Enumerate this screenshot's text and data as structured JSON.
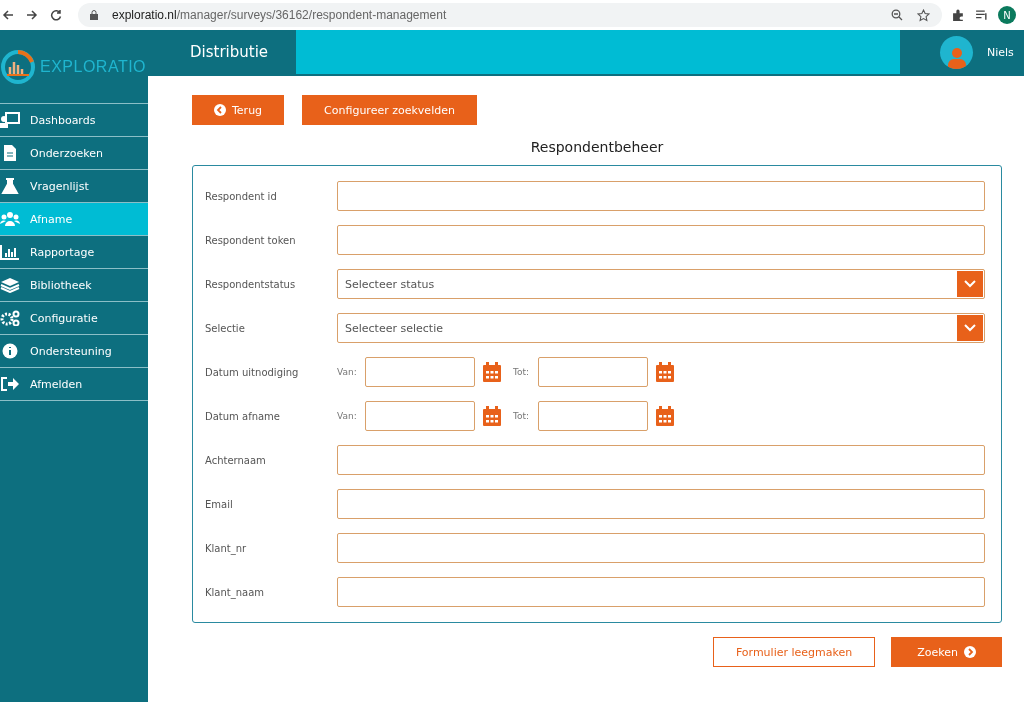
{
  "browser": {
    "url_host": "exploratio.nl",
    "url_path": "/manager/surveys/36162/respondent-management",
    "profile_initial": "N"
  },
  "logo": {
    "text": "EXPLORATIO"
  },
  "header": {
    "section": "Distributie",
    "user": "Niels"
  },
  "sidebar": {
    "items": [
      {
        "label": "Dashboards",
        "selected": false
      },
      {
        "label": "Onderzoeken",
        "selected": false
      },
      {
        "label": "Vragenlijst",
        "selected": false
      },
      {
        "label": "Afname",
        "selected": true
      },
      {
        "label": "Rapportage",
        "selected": false
      },
      {
        "label": "Bibliotheek",
        "selected": false
      },
      {
        "label": "Configuratie",
        "selected": false
      },
      {
        "label": "Ondersteuning",
        "selected": false
      },
      {
        "label": "Afmelden",
        "selected": false
      }
    ]
  },
  "toolbar": {
    "back_button": "Terug",
    "configure_button": "Configureer zoekvelden"
  },
  "form": {
    "title": "Respondentbeheer",
    "fields": [
      {
        "kind": "text",
        "label": "Respondent id"
      },
      {
        "kind": "text",
        "label": "Respondent token"
      },
      {
        "kind": "select",
        "label": "Respondentstatus",
        "placeholder": "Selecteer status"
      },
      {
        "kind": "select",
        "label": "Selectie",
        "placeholder": "Selecteer selectie"
      },
      {
        "kind": "daterange",
        "label": "Datum uitnodiging",
        "from_label": "Van:",
        "to_label": "Tot:"
      },
      {
        "kind": "daterange",
        "label": "Datum afname",
        "from_label": "Van:",
        "to_label": "Tot:"
      },
      {
        "kind": "text",
        "label": "Achternaam"
      },
      {
        "kind": "text",
        "label": "Email"
      },
      {
        "kind": "text",
        "label": "Klant_nr"
      },
      {
        "kind": "text",
        "label": "Klant_naam"
      }
    ]
  },
  "actions": {
    "reset_button": "Formulier leegmaken",
    "search_button": "Zoeken"
  }
}
